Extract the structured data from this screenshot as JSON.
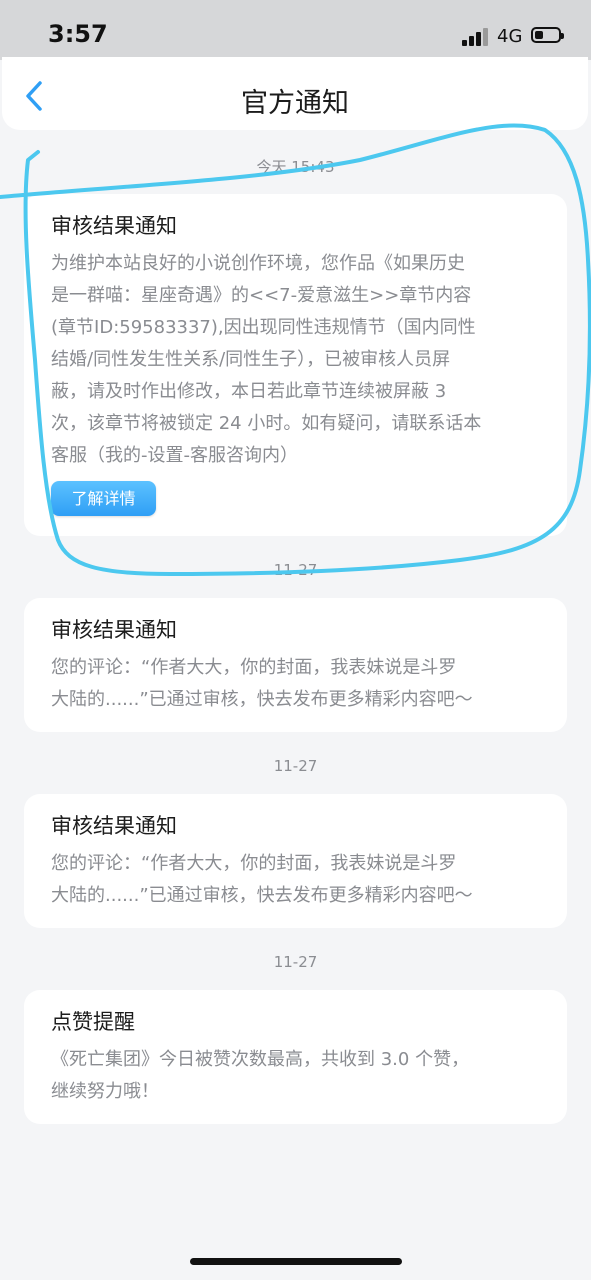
{
  "status_bar": {
    "time": "3:57",
    "network": "4G",
    "battery_level": 0.35,
    "signal_bars_active": 3
  },
  "header": {
    "title": "官方通知",
    "back_icon": "chevron-left-icon"
  },
  "notifications": [
    {
      "date": "今天 15:43",
      "title": "审核结果通知",
      "body_lines": [
        "为维护本站良好的小说创作环境，您作品《如果历史",
        "是一群喵：星座奇遇》的<<7-爱意滋生>>章节内容",
        "(章节ID:59583337),因出现同性违规情节（国内同性",
        "结婚/同性发生性关系/同性生子），已被审核人员屏",
        "蔽，请及时作出修改，本日若此章节连续被屏蔽 3",
        "次，该章节将被锁定 24 小时。如有疑问，请联系话本",
        "客服（我的-设置-客服咨询内）"
      ],
      "button_label": "了解详情"
    },
    {
      "date": "11-27",
      "title": "审核结果通知",
      "body_lines": [
        "您的评论：“作者大大，你的封面，我表妹说是斗罗",
        "大陆的......”已通过审核，快去发布更多精彩内容吧～"
      ]
    },
    {
      "date": "11-27",
      "title": "审核结果通知",
      "body_lines": [
        "您的评论：“作者大大，你的封面，我表妹说是斗罗",
        "大陆的......”已通过审核，快去发布更多精彩内容吧～"
      ]
    },
    {
      "date": "11-27",
      "title": "点赞提醒",
      "body_lines": [
        "《死亡集团》今日被赞次数最高，共收到 3.0 个赞，",
        "继续努力哦！"
      ]
    }
  ],
  "colors": {
    "accent": "#2f9ff5",
    "scribble": "#4cc8ef",
    "background": "#f4f5f7"
  }
}
